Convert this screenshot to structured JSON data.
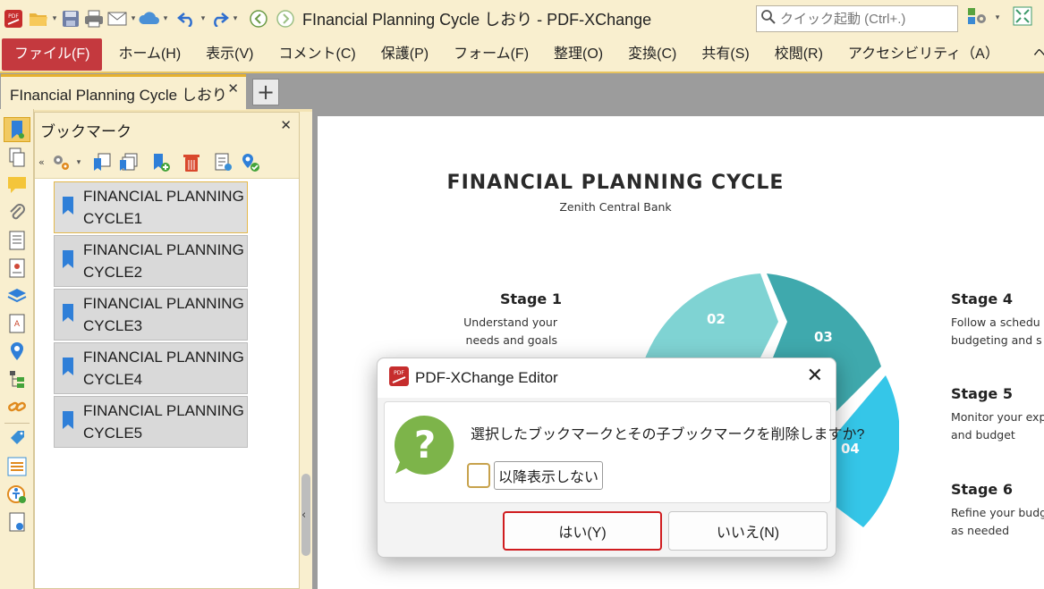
{
  "window": {
    "title": "FInancial Planning Cycle しおり - PDF-XChange Edit...",
    "search_placeholder": "クイック起動 (Ctrl+.)"
  },
  "menu": {
    "items": [
      "ファイル(F)",
      "ホーム(H)",
      "表示(V)",
      "コメント(C)",
      "保護(P)",
      "フォーム(F)",
      "整理(O)",
      "変換(C)",
      "共有(S)",
      "校閲(R)",
      "アクセシビリティ（A）",
      "ヘルプ(H)"
    ]
  },
  "tabs": {
    "active_label": "FInancial Planning Cycle しおり",
    "close_glyph": "✕",
    "new_tab_glyph": "+"
  },
  "bookmarks_panel": {
    "title": "ブックマーク",
    "close_glyph": "✕",
    "items": [
      {
        "line1": "FINANCIAL PLANNING",
        "line2": "CYCLE1",
        "selected": true
      },
      {
        "line1": "FINANCIAL PLANNING",
        "line2": "CYCLE2",
        "selected": false
      },
      {
        "line1": "FINANCIAL PLANNING",
        "line2": "CYCLE3",
        "selected": false
      },
      {
        "line1": "FINANCIAL PLANNING",
        "line2": "CYCLE4",
        "selected": false
      },
      {
        "line1": "FINANCIAL PLANNING",
        "line2": "CYCLE5",
        "selected": false
      }
    ]
  },
  "document": {
    "title": "FINANCIAL PLANNING CYCLE",
    "subtitle": "Zenith Central Bank",
    "stage1": {
      "heading": "Stage 1",
      "line1": "Understand your",
      "line2": "needs and goals"
    },
    "stage4": {
      "heading": "Stage 4",
      "line1": "Follow a schedu",
      "line2": "budgeting and s"
    },
    "stage5": {
      "heading": "Stage 5",
      "line1": "Monitor your exp",
      "line2": "and budget"
    },
    "stage6": {
      "heading": "Stage 6",
      "line1": "Refine your budg",
      "line2": "as needed"
    },
    "segments": [
      "02",
      "03",
      "04"
    ],
    "colors": {
      "seg02": "#7fd3d3",
      "seg03": "#3fa9ad",
      "seg04": "#35c6e8"
    }
  },
  "dialog": {
    "title": "PDF-XChange Editor",
    "message": "選択したブックマークとその子ブックマークを削除しますか?",
    "checkbox_label": "以降表示しない",
    "yes_label": "はい(Y)",
    "no_label": "いいえ(N)",
    "close_glyph": "✕"
  },
  "colors": {
    "chrome": "#f9efcf",
    "file_menu": "#c4393e",
    "accent_border": "#e6b12e",
    "yes_focus": "#d01c1f"
  }
}
